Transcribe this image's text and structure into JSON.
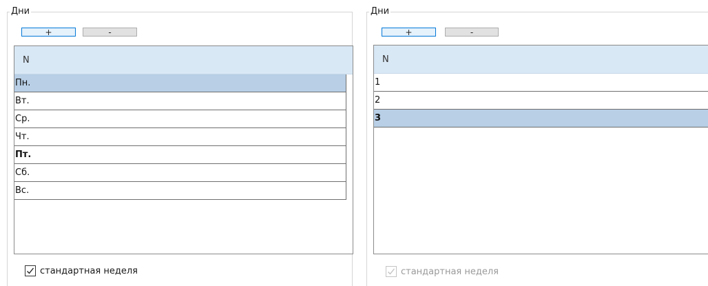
{
  "left_panel": {
    "legend": "Дни",
    "add_label": "+",
    "remove_label": "-",
    "column_header": "N",
    "rows": [
      "Пн.",
      "Вт.",
      "Ср.",
      "Чт.",
      "Пт.",
      "Сб.",
      "Вс."
    ],
    "selected_row": "Пн.",
    "bold_row": "Пт.",
    "checkbox_label": "стандартная неделя",
    "checkbox_checked": true,
    "checkbox_enabled": true
  },
  "right_panel": {
    "legend": "Дни",
    "add_label": "+",
    "remove_label": "-",
    "column_header": "N",
    "rows": [
      "1",
      "2",
      "3"
    ],
    "selected_row": "3",
    "bold_row": "3",
    "checkbox_label": "стандартная неделя",
    "checkbox_checked": true,
    "checkbox_enabled": false
  },
  "colors": {
    "header_bg": "#d9e8f5",
    "selected_row_bg": "#b8cfe6",
    "add_button_border": "#0078d7"
  },
  "icons": [
    "checkmark-icon"
  ]
}
